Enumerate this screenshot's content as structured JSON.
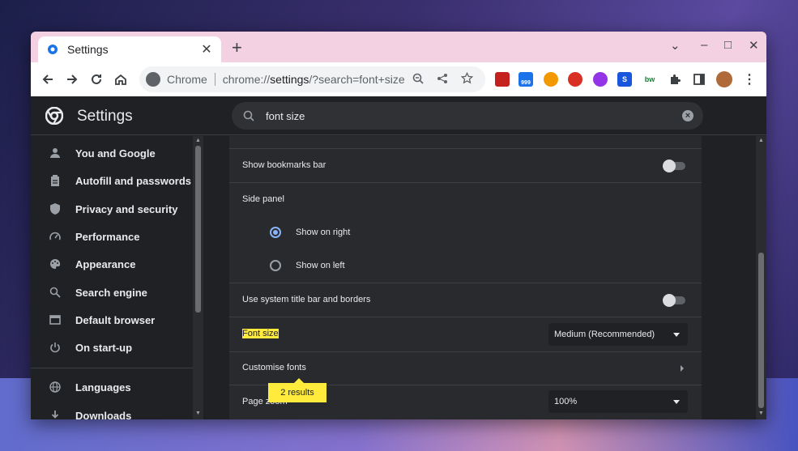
{
  "tab": {
    "title": "Settings",
    "close": "✕",
    "new_tab": "+"
  },
  "window_controls": {
    "minimize": "–",
    "maximize": "□",
    "close": "✕",
    "tab_search": "⌄"
  },
  "omnibox": {
    "site_label": "Chrome",
    "url_prefix": "chrome://",
    "url_host": "settings",
    "url_rest": "/?search=font+size"
  },
  "extensions": [
    {
      "name": "book-extension-icon",
      "color": "#c5221f",
      "text": ""
    },
    {
      "name": "rss-extension-icon",
      "color": "#1a73e8",
      "text": "999"
    },
    {
      "name": "halfcircle-extension-icon",
      "color": "#f29900",
      "text": ""
    },
    {
      "name": "red-extension-icon",
      "color": "#d93025",
      "text": ""
    },
    {
      "name": "purple-extension-icon",
      "color": "#9334e6",
      "text": ""
    },
    {
      "name": "s-extension-icon",
      "color": "#1a56db",
      "text": "S"
    },
    {
      "name": "bw-extension-icon",
      "color": "#ffffff",
      "text": "bw"
    }
  ],
  "header": {
    "title": "Settings",
    "search_value": "font size"
  },
  "sidebar": {
    "items": [
      {
        "label": "You and Google",
        "icon": "person-icon"
      },
      {
        "label": "Autofill and passwords",
        "icon": "clipboard-icon"
      },
      {
        "label": "Privacy and security",
        "icon": "shield-icon"
      },
      {
        "label": "Performance",
        "icon": "speedometer-icon"
      },
      {
        "label": "Appearance",
        "icon": "palette-icon"
      },
      {
        "label": "Search engine",
        "icon": "search-icon"
      },
      {
        "label": "Default browser",
        "icon": "browser-icon"
      },
      {
        "label": "On start-up",
        "icon": "power-icon"
      },
      {
        "label": "Languages",
        "icon": "globe-icon"
      },
      {
        "label": "Downloads",
        "icon": "download-icon"
      }
    ]
  },
  "main": {
    "show_bookmarks_bar": "Show bookmarks bar",
    "side_panel": "Side panel",
    "show_on_right": "Show on right",
    "show_on_left": "Show on left",
    "use_system_title_bar": "Use system title bar and borders",
    "font_size_label": "Font size",
    "font_size_value": "Medium (Recommended)",
    "customise_fonts": "Customise fonts",
    "page_zoom_label": "Page zoom",
    "page_zoom_value": "100%",
    "results_bubble": "2 results"
  },
  "colors": {
    "accent": "#8ab4f8",
    "highlight": "#ffeb3b",
    "background": "#202124",
    "card": "#292a2d"
  }
}
